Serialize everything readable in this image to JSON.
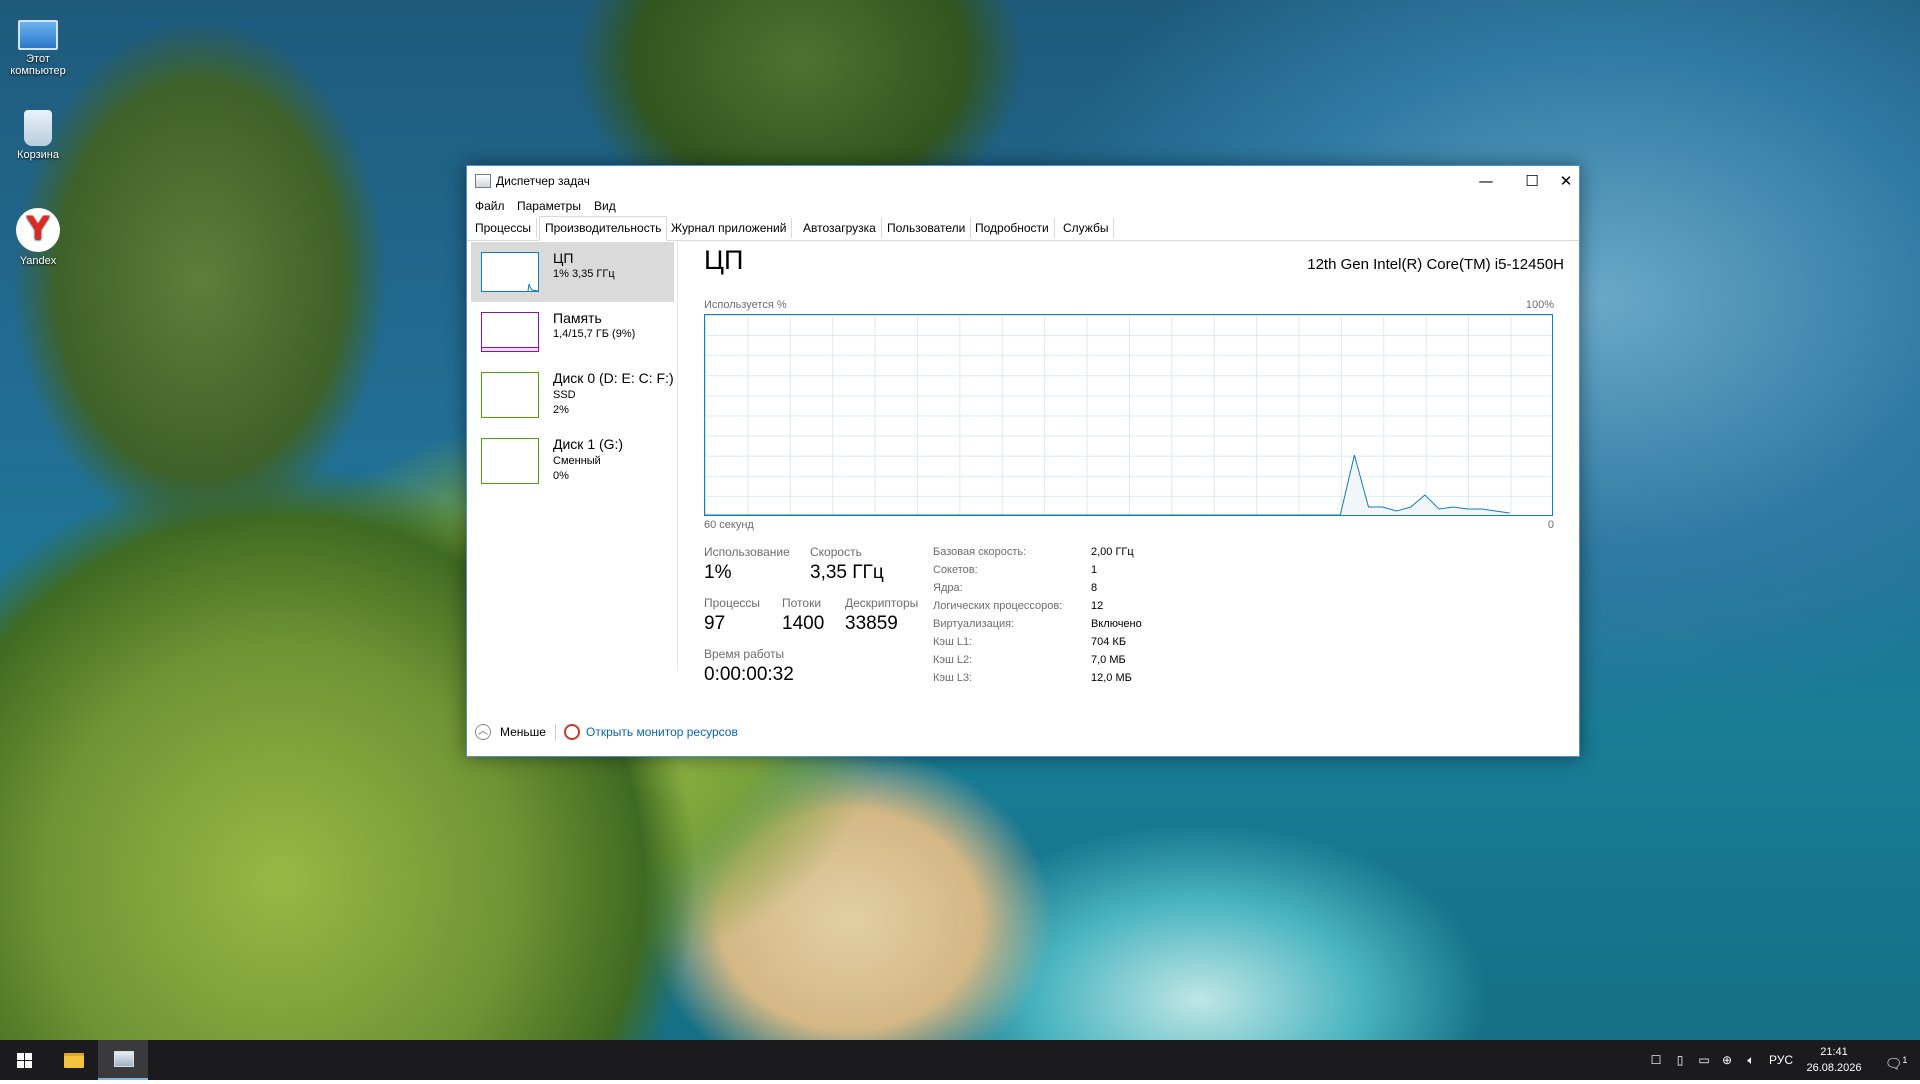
{
  "desktop": {
    "icons": [
      {
        "label": "Этот компьютер",
        "icon": "computer-icon"
      },
      {
        "label": "Корзина",
        "icon": "recycle-bin-icon"
      },
      {
        "label": "Yandex",
        "icon": "yandex-browser-icon"
      }
    ]
  },
  "window": {
    "title": "Диспетчер задач",
    "controls": {
      "minimize": "—",
      "maximize": "☐",
      "close": "✕"
    }
  },
  "menu": [
    "Файл",
    "Параметры",
    "Вид"
  ],
  "tabs": [
    "Процессы",
    "Производительность",
    "Журнал приложений",
    "Автозагрузка",
    "Пользователи",
    "Подробности",
    "Службы"
  ],
  "active_tab": "Производительность",
  "resources": [
    {
      "title": "ЦП",
      "sub1": "1% 3,35 ГГц",
      "sub2": "",
      "color": "#117dbb"
    },
    {
      "title": "Память",
      "sub1": "1,4/15,7 ГБ (9%)",
      "sub2": "",
      "color": "#8b12ae"
    },
    {
      "title": "Диск 0 (D: E: C: F:)",
      "sub1": "SSD",
      "sub2": "2%",
      "color": "#4da60c"
    },
    {
      "title": "Диск 1 (G:)",
      "sub1": "Сменный",
      "sub2": "0%",
      "color": "#4da60c"
    }
  ],
  "cpu": {
    "title": "ЦП",
    "model": "12th Gen Intel(R) Core(TM) i5-12450H",
    "graph": {
      "ylabel": "Используется %",
      "ymax_label": "100%",
      "xlabel": "60 секунд",
      "ymin_label": "0",
      "color": "#117dbb"
    },
    "stats": {
      "usage_label": "Использование",
      "usage": "1%",
      "speed_label": "Скорость",
      "speed": "3,35 ГГц",
      "processes_label": "Процессы",
      "processes": "97",
      "threads_label": "Потоки",
      "threads": "1400",
      "handles_label": "Дескрипторы",
      "handles": "33859",
      "uptime_label": "Время работы",
      "uptime": "0:00:00:32"
    },
    "specs": [
      {
        "label": "Базовая скорость:",
        "value": "2,00 ГГц"
      },
      {
        "label": "Сокетов:",
        "value": "1"
      },
      {
        "label": "Ядра:",
        "value": "8"
      },
      {
        "label": "Логических процессоров:",
        "value": "12"
      },
      {
        "label": "Виртуализация:",
        "value": "Включено"
      },
      {
        "label": "Кэш L1:",
        "value": "704 КБ"
      },
      {
        "label": "Кэш L2:",
        "value": "7,0 МБ"
      },
      {
        "label": "Кэш L3:",
        "value": "12,0 МБ"
      }
    ]
  },
  "chart_data": {
    "type": "area",
    "x": [
      0,
      1,
      2,
      3,
      4,
      5,
      6,
      7,
      8,
      9,
      10,
      11,
      12,
      13,
      14,
      15,
      16,
      17,
      18,
      19,
      20,
      21,
      22,
      23,
      24,
      25,
      26,
      27,
      28,
      29,
      30,
      31,
      32,
      33,
      34,
      35,
      36,
      37,
      38,
      39,
      40,
      41,
      42,
      43,
      44,
      45,
      46,
      47,
      48,
      49,
      50,
      51,
      52,
      53,
      54,
      55,
      56,
      57,
      58,
      59,
      60
    ],
    "series": [
      {
        "values": [
          0,
          0,
          0,
          0,
          0,
          0,
          0,
          0,
          0,
          0,
          0,
          0,
          0,
          0,
          0,
          0,
          0,
          0,
          0,
          0,
          0,
          0,
          0,
          0,
          0,
          0,
          0,
          0,
          0,
          0,
          0,
          0,
          0,
          0,
          0,
          0,
          0,
          0,
          0,
          0,
          0,
          0,
          0,
          0,
          0,
          0,
          30,
          4,
          4,
          2,
          4,
          10,
          3,
          4,
          3,
          3,
          2,
          1,
          null,
          null,
          null
        ]
      }
    ],
    "ylim": [
      0,
      100
    ],
    "xlim": [
      0,
      60
    ]
  },
  "footer": {
    "less": "Меньше",
    "monitor": "Открыть монитор ресурсов"
  },
  "taskbar": {
    "apps": [
      "start-icon",
      "file-explorer-icon",
      "task-manager-icon"
    ],
    "lang": "РУС",
    "time": "21:41",
    "date": "26.08.2026",
    "notification_count": "1"
  }
}
